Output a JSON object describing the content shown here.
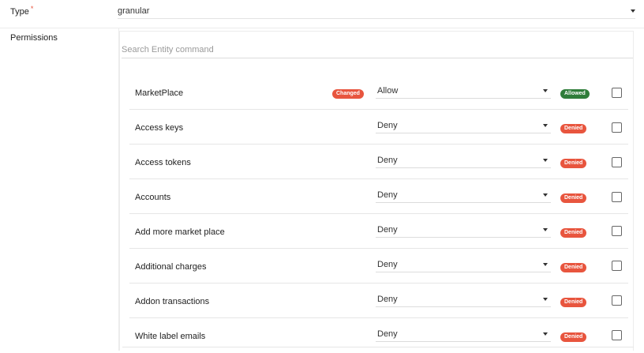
{
  "type_field": {
    "label": "Type",
    "required_mark": "*",
    "value": "granular"
  },
  "permissions": {
    "label": "Permissions",
    "search_placeholder": "Search Entity command",
    "rows": [
      {
        "name": "MarketPlace",
        "changed_badge": "Changed",
        "value": "Allow",
        "status": "Allowed",
        "status_color": "#2f7d3a",
        "checked": false
      },
      {
        "name": "Access keys",
        "value": "Deny",
        "status": "Denied",
        "status_color": "#e8553e",
        "checked": false
      },
      {
        "name": "Access tokens",
        "value": "Deny",
        "status": "Denied",
        "status_color": "#e8553e",
        "checked": false
      },
      {
        "name": "Accounts",
        "value": "Deny",
        "status": "Denied",
        "status_color": "#e8553e",
        "checked": false
      },
      {
        "name": "Add more market place",
        "value": "Deny",
        "status": "Denied",
        "status_color": "#e8553e",
        "checked": false
      },
      {
        "name": "Additional charges",
        "value": "Deny",
        "status": "Denied",
        "status_color": "#e8553e",
        "checked": false
      },
      {
        "name": "Addon transactions",
        "value": "Deny",
        "status": "Denied",
        "status_color": "#e8553e",
        "checked": false
      },
      {
        "name": "White label emails",
        "value": "Deny",
        "status": "Denied",
        "status_color": "#e8553e",
        "checked": false
      }
    ]
  },
  "colors": {
    "accent_red": "#e8553e",
    "allowed_green": "#2f7d3a"
  }
}
